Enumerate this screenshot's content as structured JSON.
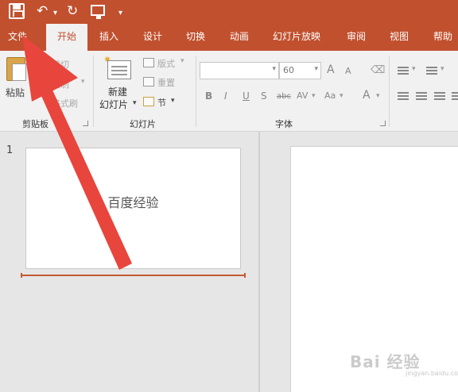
{
  "quick_access": {
    "save_icon": "save-icon",
    "undo_icon": "undo-icon",
    "redo_icon": "redo-icon",
    "present_icon": "present-from-start-icon",
    "customize_icon": "customize-quick-access-icon"
  },
  "tabs": [
    {
      "label": "文件"
    },
    {
      "label": "开始"
    },
    {
      "label": "插入"
    },
    {
      "label": "设计"
    },
    {
      "label": "切换"
    },
    {
      "label": "动画"
    },
    {
      "label": "幻灯片放映"
    },
    {
      "label": "审阅"
    },
    {
      "label": "视图"
    },
    {
      "label": "帮助"
    }
  ],
  "active_tab": "开始",
  "ribbon": {
    "clipboard": {
      "paste": "粘贴",
      "cut": "剪切",
      "copy": "复制",
      "format_painter": "格式刷",
      "group_label": "剪贴板"
    },
    "slides": {
      "new_slide_line1": "新建",
      "new_slide_line2": "幻灯片",
      "layout": "版式",
      "reset": "重置",
      "section": "节",
      "group_label": "幻灯片"
    },
    "font": {
      "font_name": "",
      "font_size": "60",
      "bold": "B",
      "italic": "I",
      "underline": "U",
      "shadow": "S",
      "strikethrough": "abc",
      "char_spacing": "AV",
      "change_case": "Aa",
      "font_color": "A",
      "grow": "A",
      "shrink": "A",
      "group_label": "字体"
    }
  },
  "slides_panel": {
    "slide_number": "1",
    "slide_text": "百度经验"
  },
  "watermark": {
    "text": "Bai 经验",
    "sub": "jingyan.baidu.com"
  },
  "colors": {
    "accent": "#c1502e",
    "ribbon_bg": "#f1f1f1",
    "arrow": "#e8453c"
  }
}
